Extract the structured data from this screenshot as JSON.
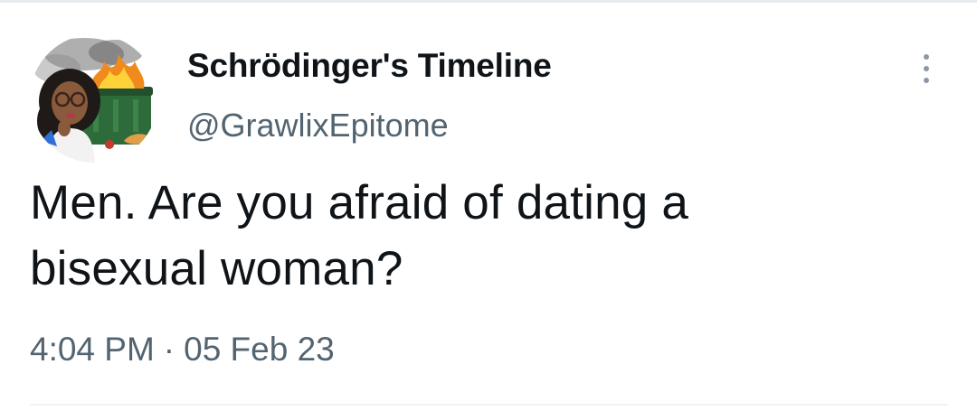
{
  "tweet": {
    "author": {
      "display_name": "Schrödinger's Timeline",
      "handle": "@GrawlixEpitome",
      "avatar_icon": "bitmoji-dumpster-fire-avatar"
    },
    "text": "Men. Are you afraid of dating a\nbisexual woman?",
    "time": "4:04 PM",
    "separator": "·",
    "date": "05 Feb 23",
    "more_icon": "vertical-ellipsis-icon"
  },
  "colors": {
    "name": "#0f1419",
    "secondary": "#536471",
    "divider": "#eff3f4"
  }
}
